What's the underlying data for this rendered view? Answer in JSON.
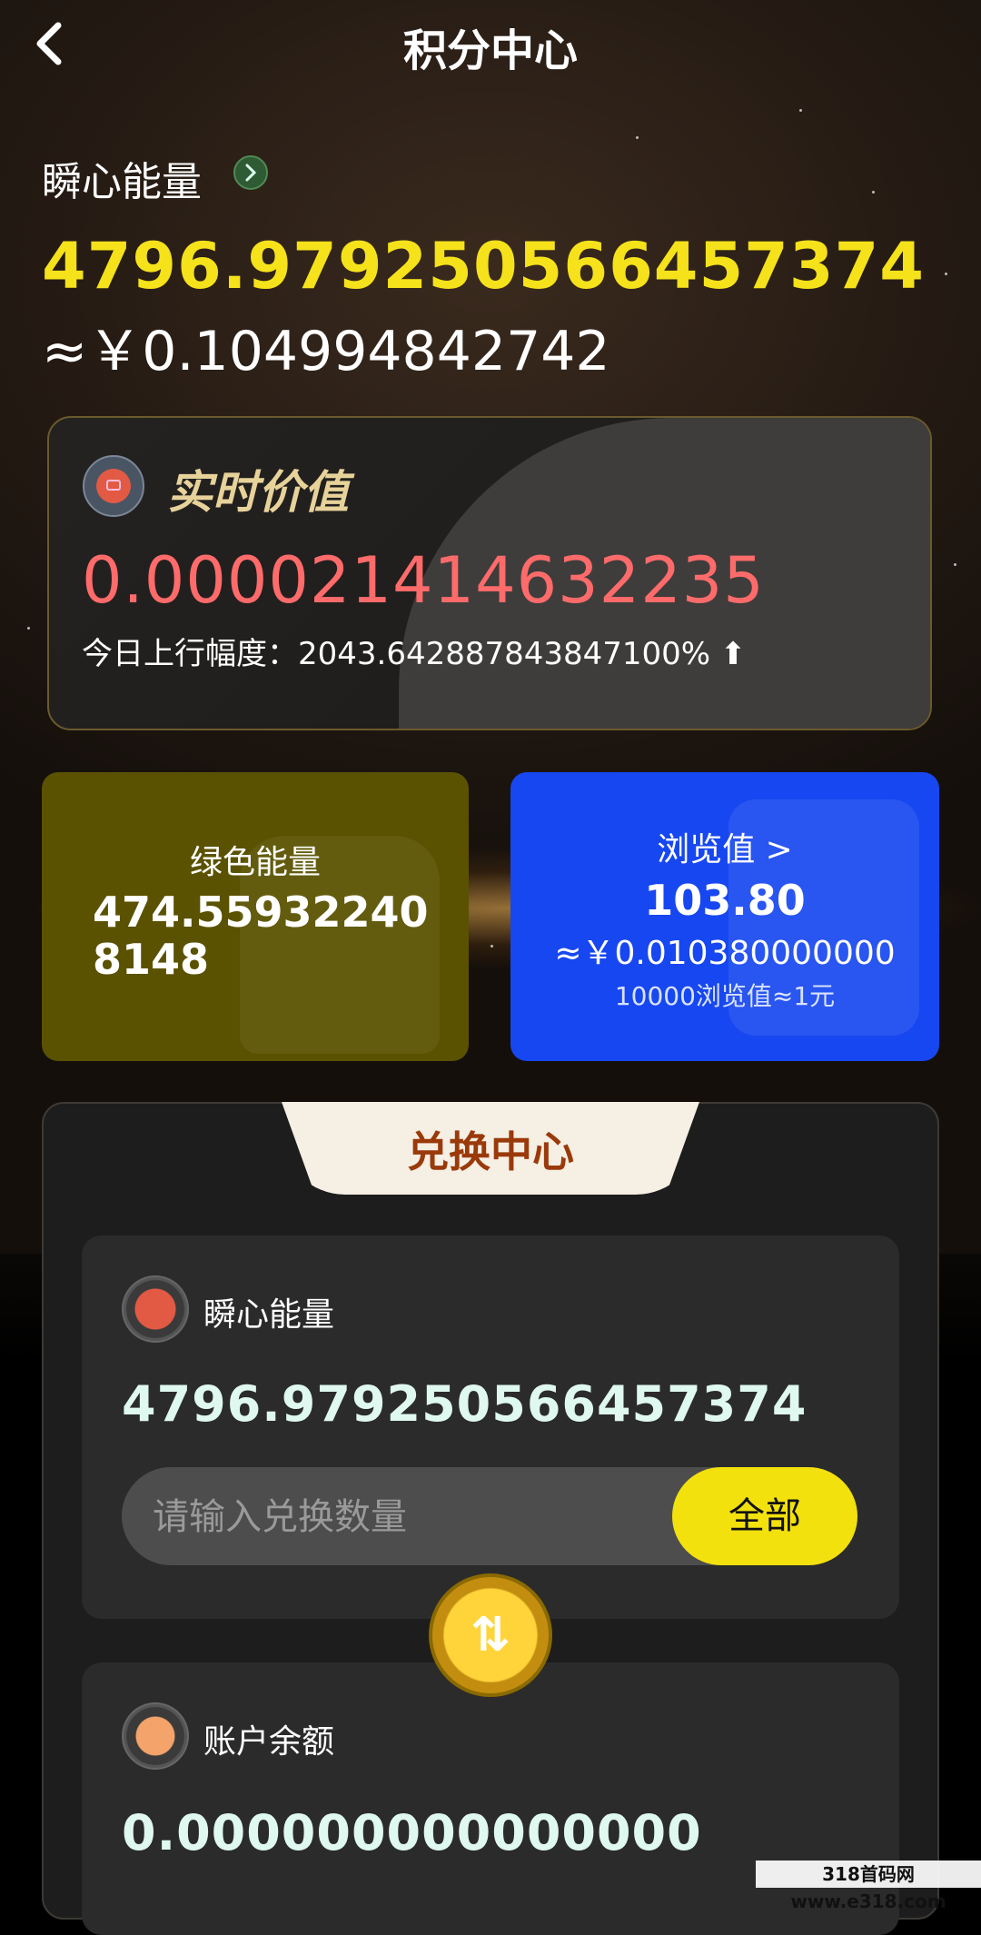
{
  "header": {
    "title": "积分中心",
    "back_icon": "chevron-left-icon"
  },
  "energy": {
    "label": "瞬心能量",
    "value": "4796.979250566457374",
    "rmb": "≈￥0.104994842742"
  },
  "realtime": {
    "label": "实时价值",
    "value": "0.000021414632235",
    "change": "今日上行幅度：2043.642887843847100% ⬆"
  },
  "green": {
    "title": "绿色能量",
    "value": "474.559322408148"
  },
  "browse": {
    "title": "浏览值 >",
    "value": "103.80",
    "rmb": "≈￥0.010380000000",
    "rate": "10000浏览值≈1元"
  },
  "exchange": {
    "title": "兑换中心",
    "from": {
      "label": "瞬心能量",
      "value": "4796.979250566457374",
      "placeholder": "请输入兑换数量",
      "all_button": "全部"
    },
    "swap_glyph": "⇅",
    "to": {
      "label": "账户余额",
      "value": "0.000000000000000"
    }
  },
  "watermark": "318首码网 www.e318.com",
  "colors": {
    "accent_yellow": "#f5e21a",
    "red_value": "#ff6b6b",
    "blue_card": "#1747f0",
    "olive_card": "#5a5200",
    "exchange_title": "#9a3a0a"
  }
}
